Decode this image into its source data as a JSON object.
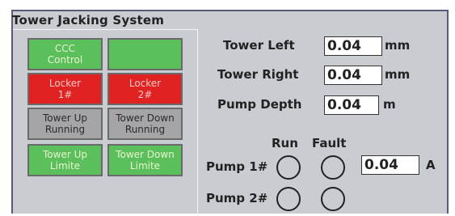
{
  "title": "Tower Jacking System",
  "buttons": [
    {
      "label": "CCC\nControl"
    },
    {
      "label": ""
    },
    {
      "label": "Locker\n1#"
    },
    {
      "label": "Locker\n2#"
    },
    {
      "label": "Tower Up\nRunning"
    },
    {
      "label": "Tower Down\nRunning"
    },
    {
      "label": "Tower Up\nLimite"
    },
    {
      "label": "Tower Down\nLimite"
    }
  ],
  "readouts": [
    {
      "label": "Tower Left",
      "value": "0.04",
      "unit": "mm"
    },
    {
      "label": "Tower Right",
      "value": "0.04",
      "unit": "mm"
    },
    {
      "label": "Pump Depth",
      "value": "0.04",
      "unit": "m"
    }
  ],
  "status": {
    "run_header": "Run",
    "fault_header": "Fault",
    "pumps": [
      {
        "label": "Pump 1#",
        "current": "0.04",
        "current_unit": "A"
      },
      {
        "label": "Pump 2#"
      }
    ]
  },
  "colors": {
    "green": "#5bbf5b",
    "red": "#e02222",
    "gray": "#a5a5a8",
    "panel": "#c9cdd1"
  }
}
